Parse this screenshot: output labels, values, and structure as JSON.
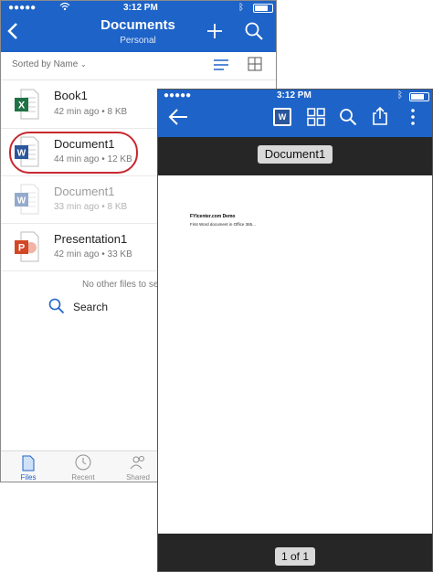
{
  "phone1": {
    "status": {
      "time": "3:12 PM"
    },
    "header": {
      "title": "Documents",
      "subtitle": "Personal"
    },
    "sort_label": "Sorted by Name",
    "files": [
      {
        "name": "Book1",
        "meta": "42 min ago • 8 KB",
        "icon": "excel-icon"
      },
      {
        "name": "Document1",
        "meta": "44 min ago • 12 KB",
        "icon": "word-icon"
      },
      {
        "name": "Document1",
        "meta": "33 min ago • 8 KB",
        "icon": "word-icon"
      },
      {
        "name": "Presentation1",
        "meta": "42 min ago • 33 KB",
        "icon": "powerpoint-icon"
      }
    ],
    "no_more_text": "No other files to se",
    "search_label": "Search",
    "tabs": [
      {
        "label": "Files",
        "icon": "file-icon",
        "active": true
      },
      {
        "label": "Recent",
        "icon": "clock-icon",
        "active": false
      },
      {
        "label": "Shared",
        "icon": "people-icon",
        "active": false
      }
    ],
    "colors": {
      "brand": "#1e63c8",
      "highlight_circle": "#c8282f",
      "excel": "#1f7244",
      "word": "#2b579a",
      "powerpoint": "#d24726"
    }
  },
  "phone2": {
    "status": {
      "time": "3:12 PM"
    },
    "doc_title": "Document1",
    "page_heading": "FYIcenter.com Demo",
    "page_body": "First Word document in Office 365...",
    "page_indicator": "1 of 1"
  }
}
